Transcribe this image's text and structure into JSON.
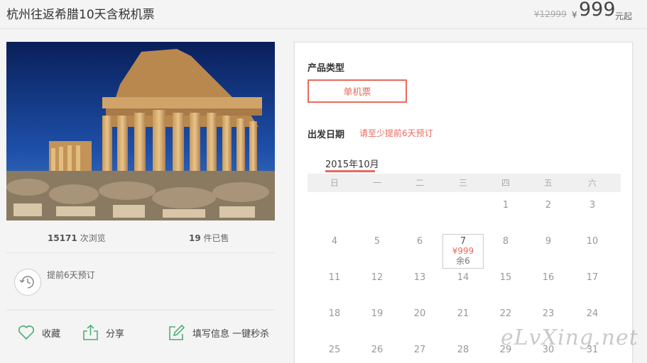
{
  "header": {
    "title": "杭州往返希腊10天含税机票",
    "old_price": "¥12999",
    "currency": "¥",
    "price": "999",
    "price_unit": "元起"
  },
  "stats": {
    "views_count": "15171",
    "views_label": "次浏览",
    "sold_count": "19",
    "sold_label": "件已售"
  },
  "advance_notice": "提前6天预订",
  "actions": {
    "favorite": "收藏",
    "share": "分享",
    "fill_info": "填写信息 一键秒杀"
  },
  "booking": {
    "product_type_label": "产品类型",
    "product_type_option": "单机票",
    "departure_label": "出发日期",
    "departure_note": "请至少提前6天预订",
    "month": "2015年10月",
    "weekdays": [
      "日",
      "一",
      "二",
      "三",
      "四",
      "五",
      "六"
    ],
    "weeks": [
      [
        "",
        "",
        "",
        "",
        "1",
        "2",
        "3"
      ],
      [
        "4",
        "5",
        "6",
        "7",
        "8",
        "9",
        "10"
      ],
      [
        "11",
        "12",
        "13",
        "14",
        "15",
        "16",
        "17"
      ],
      [
        "18",
        "19",
        "20",
        "21",
        "22",
        "23",
        "24"
      ],
      [
        "25",
        "26",
        "27",
        "28",
        "29",
        "30",
        "31"
      ]
    ],
    "selected_day": {
      "day": "7",
      "price": "¥999",
      "remaining": "余6"
    }
  },
  "watermark": "eLvXing.net",
  "colors": {
    "accent": "#e96a5e",
    "icon_green": "#4caf74"
  }
}
